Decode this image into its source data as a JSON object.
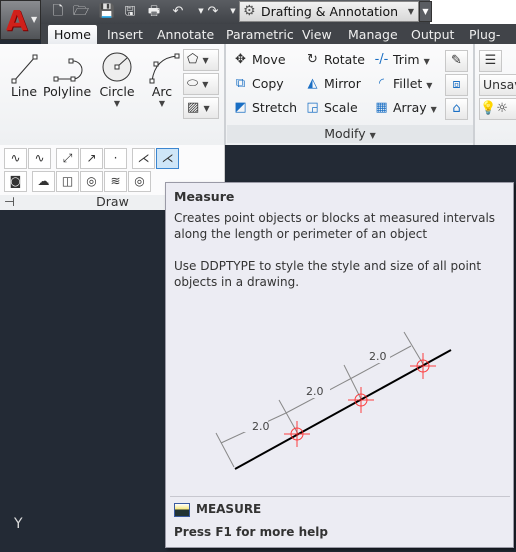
{
  "quick_access": {
    "icons": [
      "new-icon",
      "open-icon",
      "save-icon",
      "save-as-icon",
      "plot-icon",
      "undo-icon",
      "redo-icon"
    ],
    "workspace": "Drafting & Annotation"
  },
  "tabs": [
    "Home",
    "Insert",
    "Annotate",
    "Parametric",
    "View",
    "Manage",
    "Output",
    "Plug-ins"
  ],
  "active_tab": "Home",
  "draw": {
    "big": [
      "Line",
      "Polyline",
      "Circle",
      "Arc"
    ],
    "label": "Draw"
  },
  "modify": {
    "items": [
      "Move",
      "Rotate",
      "Trim",
      "Copy",
      "Mirror",
      "Fillet",
      "Stretch",
      "Scale",
      "Array"
    ],
    "label": "Modify"
  },
  "layers": {
    "current": "Unsave"
  },
  "tooltip": {
    "title": "Measure",
    "description": "Creates point objects or blocks at measured intervals along the length or perimeter of an object",
    "detail": "Use DDPTYPE to style the style and size of all point objects in a drawing.",
    "dim_labels": [
      "2.0",
      "2.0",
      "2.0"
    ],
    "command": "MEASURE",
    "help": "Press F1 for more help"
  },
  "canvas": {
    "ucs_label": "Y"
  },
  "colors": {
    "accent": "#d0201a",
    "canvas": "#232a35",
    "marker": "#ff2020"
  }
}
